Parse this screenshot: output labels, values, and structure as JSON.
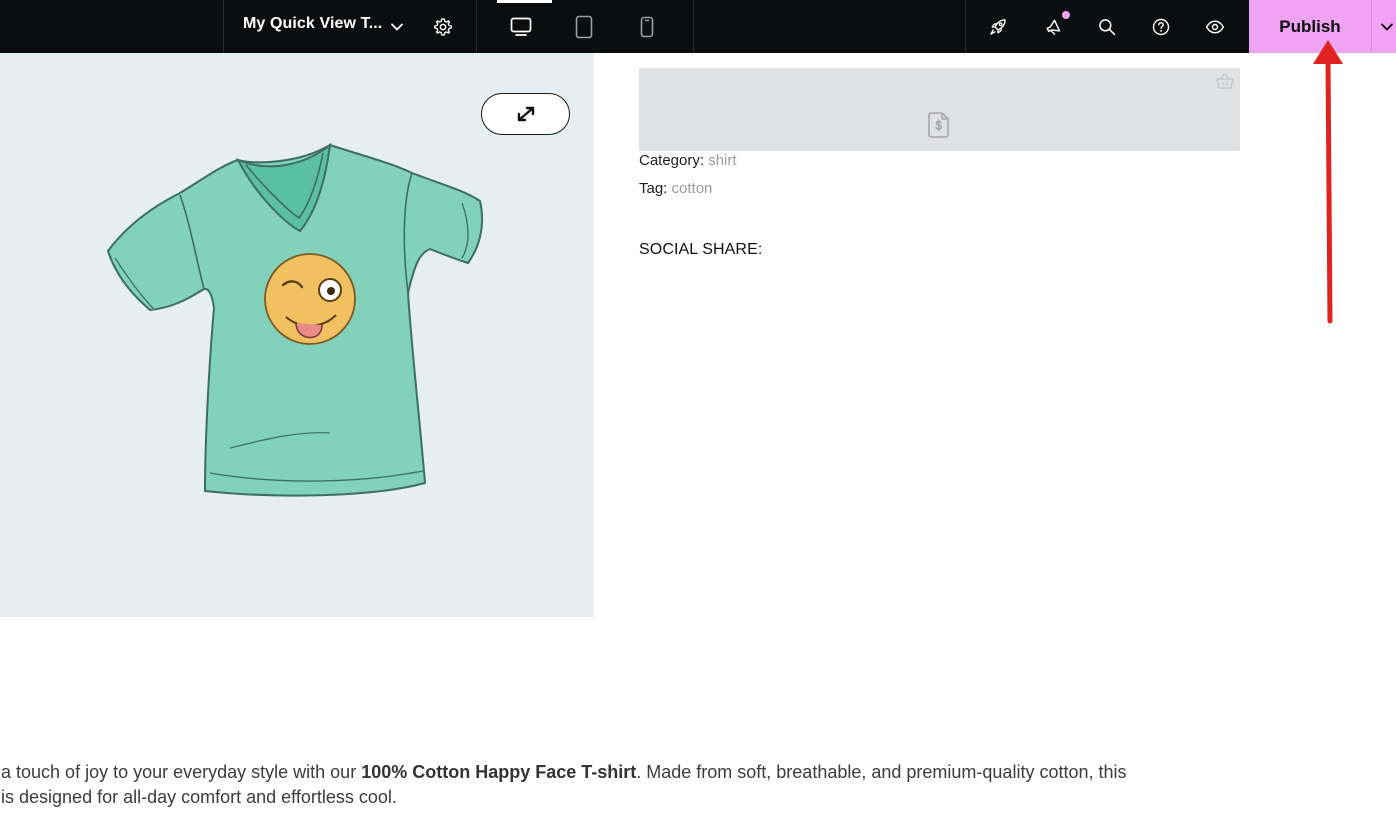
{
  "header": {
    "document_title": "My Quick View T...",
    "publish_label": "Publish",
    "icons": {
      "title_dropdown": "chevron-down-icon",
      "settings": "gear-icon",
      "desktop": "desktop-icon",
      "tablet": "tablet-icon",
      "mobile": "mobile-icon",
      "launch": "rocket-icon",
      "notifications": "megaphone-icon",
      "search": "search-icon",
      "help": "help-icon",
      "preview": "eye-icon",
      "publish_options": "chevron-down-icon"
    },
    "active_device": "desktop"
  },
  "product": {
    "category_label": "Category:",
    "category_value": "shirt",
    "tag_label": "Tag:",
    "tag_value": "cotton",
    "social_share_label": "SOCIAL SHARE:",
    "cart_icon": "basket-icon",
    "placeholder_icon": "price-tag-document-icon",
    "expand_icon": "expand-arrows-icon"
  },
  "description": {
    "line1_prefix": "d a touch of joy to your everyday style with our ",
    "line1_bold": "100% Cotton Happy Face T-shirt",
    "line1_suffix": ". Made from soft, breathable, and premium-quality cotton, this",
    "line2": "e is designed for all-day comfort and effortless cool."
  },
  "colors": {
    "topbar_bg": "#0c0d0e",
    "publish_bg": "#f0a3f2",
    "annotation_arrow": "#e0231f",
    "gallery_bg": "#e7eef1"
  }
}
